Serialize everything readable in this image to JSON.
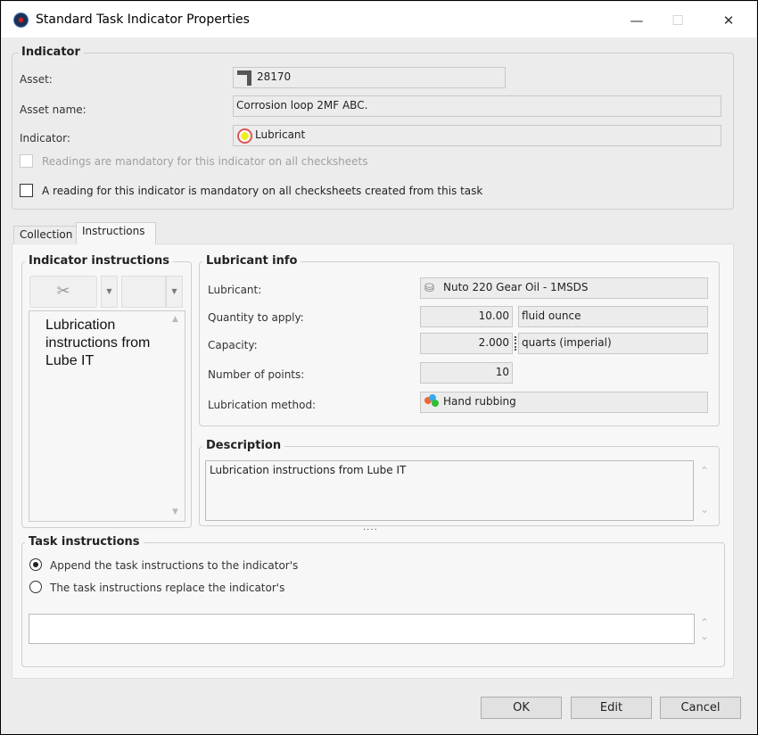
{
  "window": {
    "title": "Standard Task Indicator Properties",
    "minimize": "—",
    "maximize": "☐",
    "close": "✕"
  },
  "indicator_group": {
    "label": "Indicator",
    "asset_label": "Asset:",
    "asset_value": "28170",
    "asset_name_label": "Asset name:",
    "asset_name_value": "Corrosion loop 2MF ABC.",
    "indicator_label": "Indicator:",
    "indicator_value": "Lubricant",
    "readings_mandatory": "Readings are mandatory for this indicator on all checksheets",
    "reading_mandatory_task": "A reading for this indicator is mandatory on all checksheets created from this task"
  },
  "tabs": [
    {
      "label": "Collection"
    },
    {
      "label": "Instructions"
    }
  ],
  "indicator_instructions": {
    "label": "Indicator instructions",
    "text": "Lubrication instructions from Lube IT"
  },
  "lubricant_info": {
    "label": "Lubricant info",
    "lubricant_label": "Lubricant:",
    "lubricant_value": "Nuto 220 Gear Oil - 1MSDS",
    "quantity_label": "Quantity to apply:",
    "quantity_value": "10.00",
    "quantity_unit": "fluid ounce",
    "capacity_label": "Capacity:",
    "capacity_value": "2.000",
    "capacity_unit": "quarts (imperial)",
    "points_label": "Number of points:",
    "points_value": "10",
    "method_label": "Lubrication method:",
    "method_value": "Hand rubbing"
  },
  "description": {
    "label": "Description",
    "text": "Lubrication instructions from Lube IT"
  },
  "task_instructions": {
    "label": "Task instructions",
    "append": "Append the task instructions to the indicator's",
    "replace": "The task instructions replace the indicator's",
    "text": ""
  },
  "buttons": {
    "ok": "OK",
    "edit": "Edit",
    "cancel": "Cancel"
  }
}
